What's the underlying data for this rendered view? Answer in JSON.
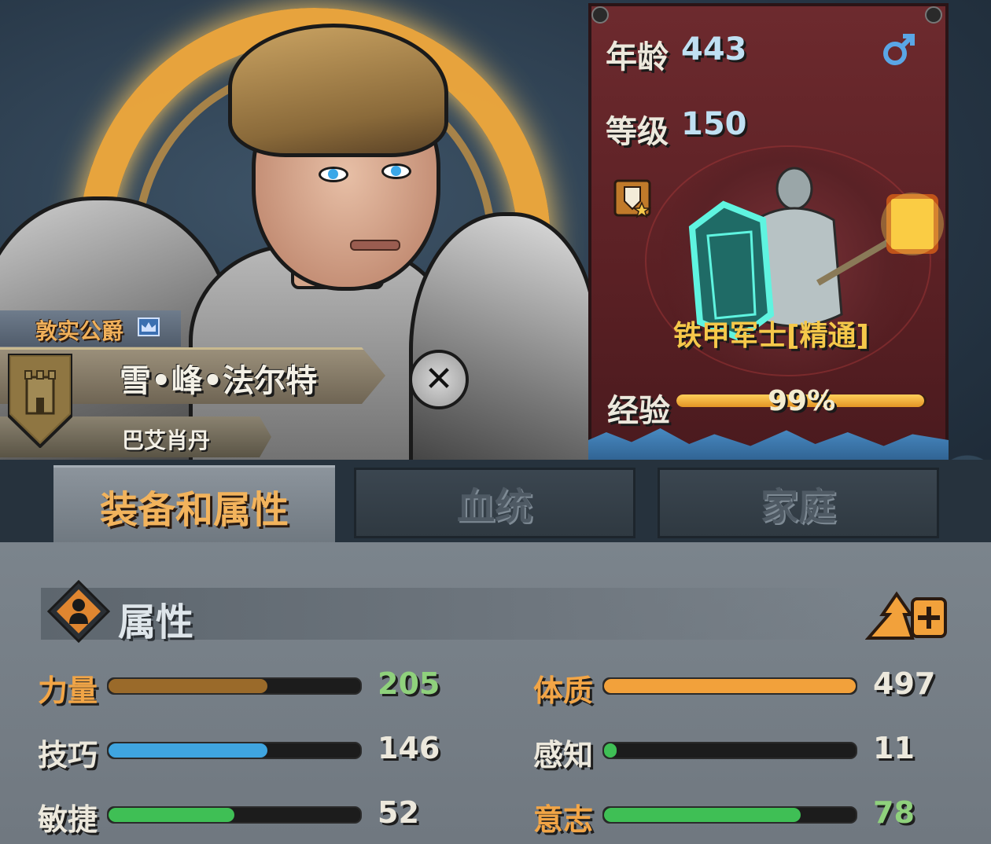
{
  "character": {
    "title": "敦实公爵",
    "name": "雪•峰•法尔特",
    "house": "巴艾肖丹"
  },
  "info": {
    "age_label": "年龄",
    "age_value": "443",
    "level_label": "等级",
    "level_value": "150",
    "class_name": "铁甲军士[精通]",
    "exp_label": "经验",
    "exp_percent_text": "99%",
    "exp_fraction": 0.99,
    "gender_icon": "male-icon"
  },
  "tabs": [
    {
      "label": "装备和属性",
      "active": true
    },
    {
      "label": "血统",
      "active": false
    },
    {
      "label": "家庭",
      "active": false
    }
  ],
  "attributes_section": {
    "title": "属性",
    "attributes": [
      {
        "label": "力量",
        "value": "205",
        "fraction": 0.63,
        "label_color": "#f2a546",
        "value_color": "#8fd17c",
        "bar_color": "#9a6a2a"
      },
      {
        "label": "体质",
        "value": "497",
        "fraction": 1.0,
        "label_color": "#f2a546",
        "value_color": "#ece8dc",
        "bar_color": "#f2a13b"
      },
      {
        "label": "技巧",
        "value": "146",
        "fraction": 0.63,
        "label_color": "#ece8dc",
        "value_color": "#ece8dc",
        "bar_color": "#3fa5e0"
      },
      {
        "label": "感知",
        "value": "11",
        "fraction": 0.05,
        "label_color": "#ece8dc",
        "value_color": "#ece8dc",
        "bar_color": "#3fbf55"
      },
      {
        "label": "敏捷",
        "value": "52",
        "fraction": 0.5,
        "label_color": "#ece8dc",
        "value_color": "#ece8dc",
        "bar_color": "#3fbf55"
      },
      {
        "label": "意志",
        "value": "78",
        "fraction": 0.78,
        "label_color": "#f2a546",
        "value_color": "#8fd17c",
        "bar_color": "#3fbf55"
      }
    ]
  }
}
